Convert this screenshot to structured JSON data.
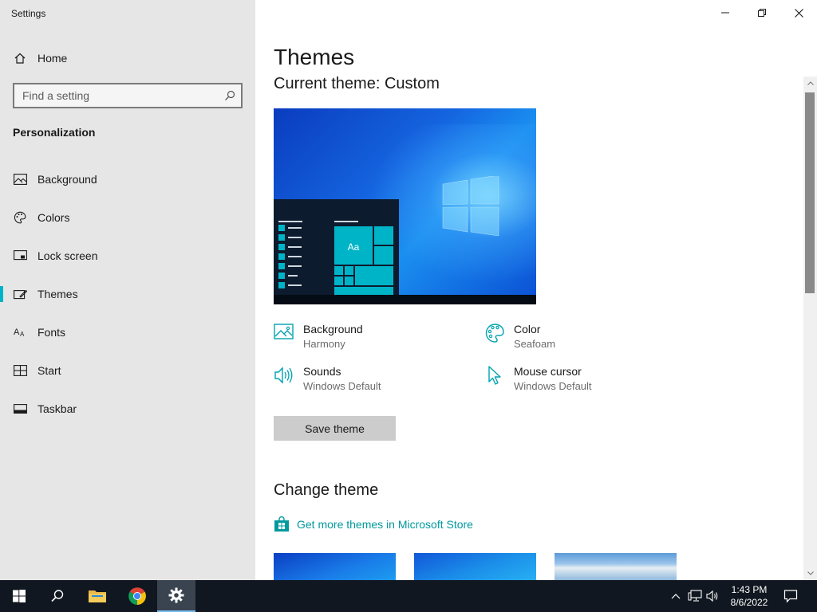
{
  "app_title": "Settings",
  "sidebar": {
    "home_label": "Home",
    "search_placeholder": "Find a setting",
    "section_heading": "Personalization",
    "items": [
      {
        "label": "Background",
        "icon": "picture-icon"
      },
      {
        "label": "Colors",
        "icon": "palette-icon"
      },
      {
        "label": "Lock screen",
        "icon": "lock-screen-icon"
      },
      {
        "label": "Themes",
        "icon": "themes-icon",
        "selected": true
      },
      {
        "label": "Fonts",
        "icon": "fonts-icon"
      },
      {
        "label": "Start",
        "icon": "start-icon"
      },
      {
        "label": "Taskbar",
        "icon": "taskbar-icon"
      }
    ]
  },
  "main": {
    "title": "Themes",
    "current_theme": "Current theme: Custom",
    "preview_tile_text": "Aa",
    "properties": [
      {
        "name": "Background",
        "value": "Harmony",
        "icon": "picture-icon"
      },
      {
        "name": "Color",
        "value": "Seafoam",
        "icon": "palette-icon"
      },
      {
        "name": "Sounds",
        "value": "Windows Default",
        "icon": "speaker-icon"
      },
      {
        "name": "Mouse cursor",
        "value": "Windows Default",
        "icon": "cursor-icon"
      }
    ],
    "save_button": "Save theme",
    "change_theme_heading": "Change theme",
    "store_link": "Get more themes in Microsoft Store"
  },
  "taskbar": {
    "time": "1:43 PM",
    "date": "8/6/2022"
  },
  "colors": {
    "accent": "#00b4c8",
    "link": "#00999e",
    "sidebar_bg": "#e6e6e6",
    "taskbar_bg": "#101720"
  }
}
